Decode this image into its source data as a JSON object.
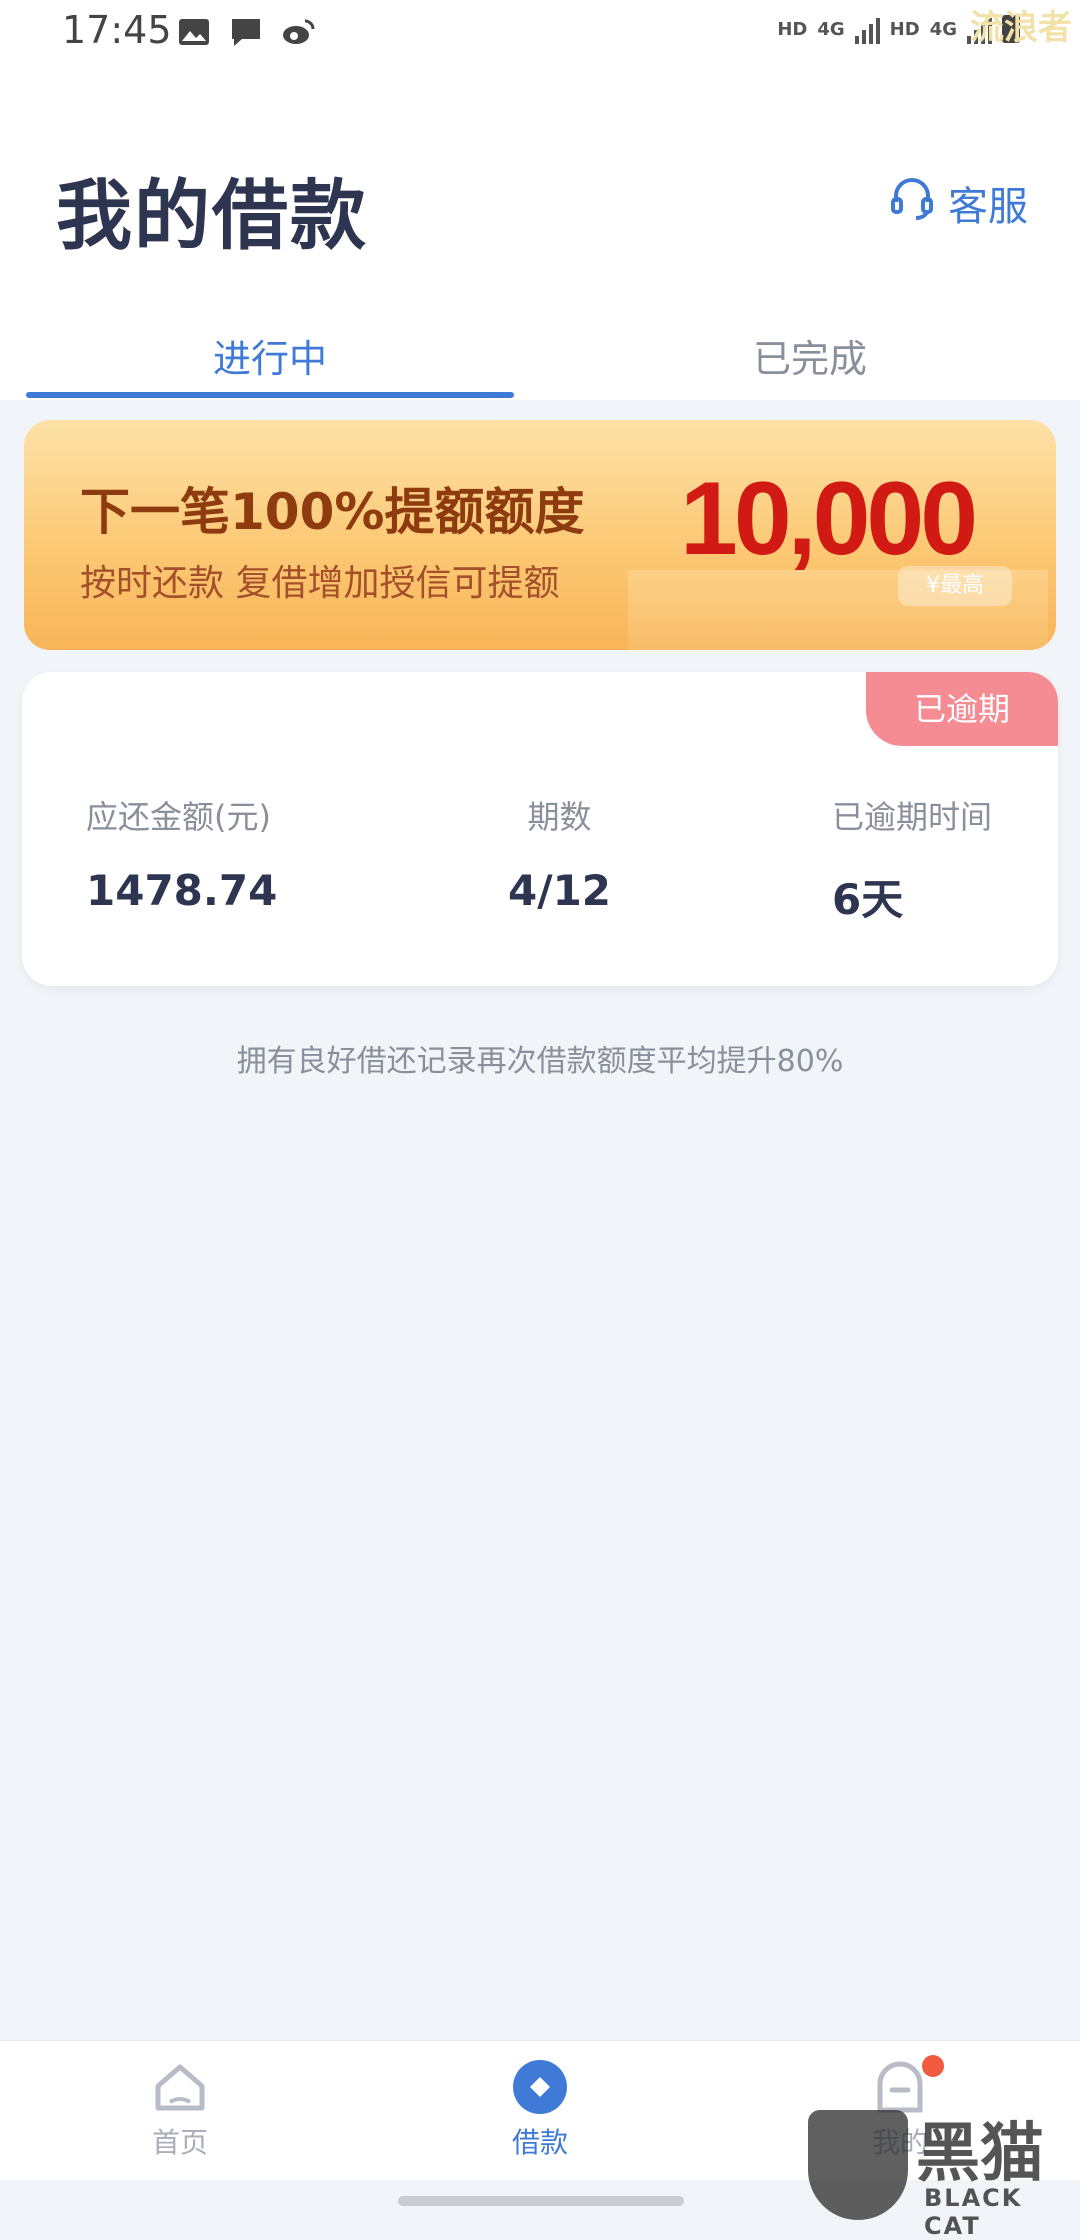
{
  "status_bar": {
    "time": "17:45",
    "left_icons": [
      "image-icon",
      "message-icon",
      "weibo-icon"
    ],
    "hd1": "HD",
    "net": "4G",
    "hd2": "HD",
    "net2": "4G",
    "watermark": "流浪者"
  },
  "header": {
    "title": "我的借款",
    "service_label": "客服",
    "service_icon": "headset-icon"
  },
  "tabs": [
    {
      "label": "进行中",
      "active": true
    },
    {
      "label": "已完成",
      "active": false
    }
  ],
  "banner": {
    "title": "下一笔100%提额额度",
    "subtitle": "按时还款  复借增加授信可提额",
    "amount": "10,000",
    "tag": "¥最高"
  },
  "loan_card": {
    "badge": "已逾期",
    "amount_label": "应还金额(元)",
    "amount_value": "1478.74",
    "term_label": "期数",
    "term_value": "4/12",
    "overdue_label": "已逾期时间",
    "overdue_value": "6天"
  },
  "tip": "拥有良好借还记录再次借款额度平均提升80%",
  "bottom_nav": {
    "home_label": "首页",
    "loan_label": "借款",
    "me_label": "我的"
  },
  "watermark": {
    "brand": "黑猫",
    "brand_en": "BLACK CAT"
  },
  "colors": {
    "accent": "#3f7bd6",
    "badge": "#f58c94",
    "banner_amount": "#d11a13"
  }
}
